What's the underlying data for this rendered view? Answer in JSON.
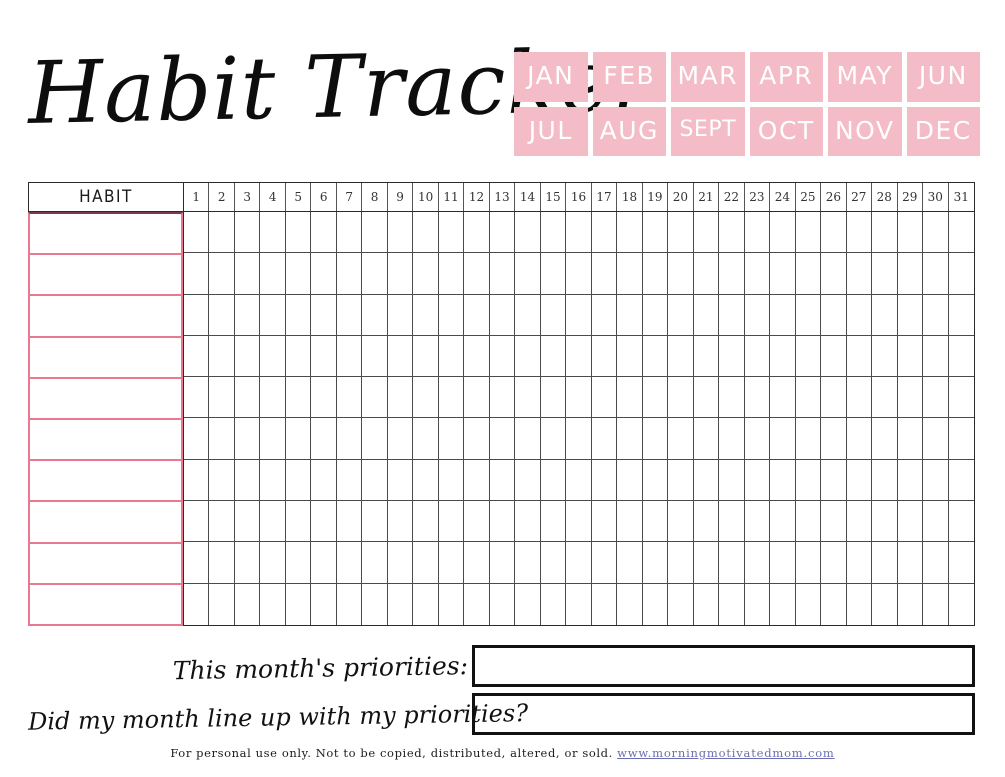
{
  "page": {
    "title": "Habit Tracker",
    "accent_pink": "#f3bcc6",
    "row_pink": "#e8798f",
    "link_color": "#6b6fb0"
  },
  "months": [
    {
      "label": "JAN"
    },
    {
      "label": "FEB"
    },
    {
      "label": "MAR"
    },
    {
      "label": "APR"
    },
    {
      "label": "MAY"
    },
    {
      "label": "JUN"
    },
    {
      "label": "JUL"
    },
    {
      "label": "AUG"
    },
    {
      "label": "SEPT"
    },
    {
      "label": "OCT"
    },
    {
      "label": "NOV"
    },
    {
      "label": "DEC"
    }
  ],
  "tracker": {
    "habit_header": "HABIT",
    "days": [
      "1",
      "2",
      "3",
      "4",
      "5",
      "6",
      "7",
      "8",
      "9",
      "10",
      "11",
      "12",
      "13",
      "14",
      "15",
      "16",
      "17",
      "18",
      "19",
      "20",
      "21",
      "22",
      "23",
      "24",
      "25",
      "26",
      "27",
      "28",
      "29",
      "30",
      "31"
    ],
    "habit_rows": [
      "",
      "",
      "",
      "",
      "",
      "",
      "",
      "",
      "",
      ""
    ]
  },
  "prompts": [
    {
      "label": "This month's priorities:",
      "value": ""
    },
    {
      "label": "Did my month line up with my priorities?",
      "value": ""
    }
  ],
  "footer": {
    "text": "For personal use only. Not to be copied, distributed, altered, or sold.",
    "link": "www.morningmotivatedmom.com"
  }
}
